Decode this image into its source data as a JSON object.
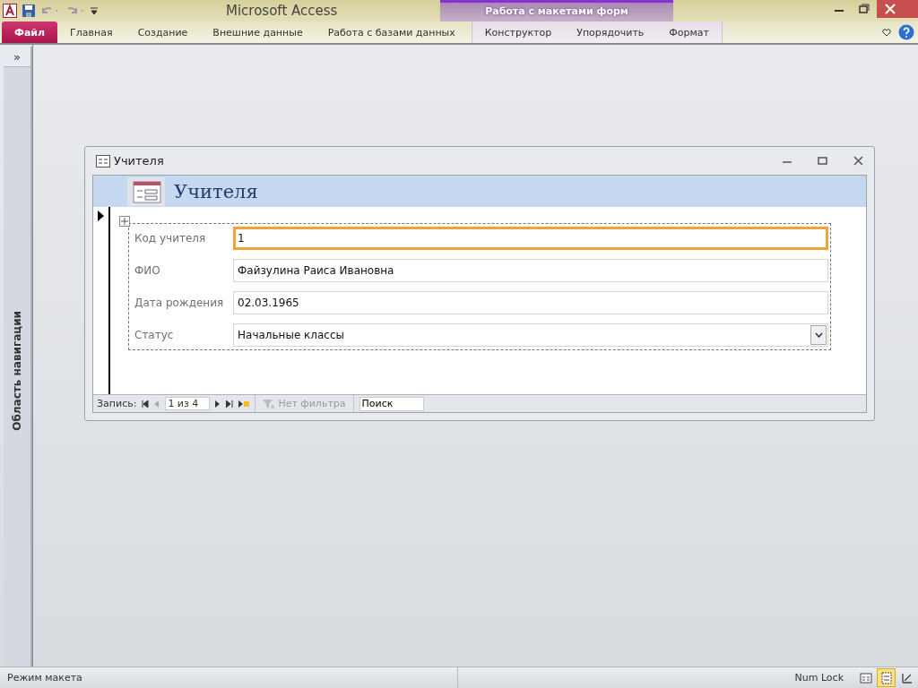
{
  "window": {
    "title": "Microsoft Access",
    "contextual_group": "Работа с макетами форм"
  },
  "ribbon_tabs": [
    {
      "label": "Файл",
      "kind": "file",
      "selected": false
    },
    {
      "label": "Главная",
      "kind": "tab",
      "selected": false
    },
    {
      "label": "Создание",
      "kind": "tab",
      "selected": false
    },
    {
      "label": "Внешние данные",
      "kind": "tab",
      "selected": false
    },
    {
      "label": "Работа с базами данных",
      "kind": "tab",
      "selected": false
    },
    {
      "label": "Конструктор",
      "kind": "context",
      "selected": false
    },
    {
      "label": "Упорядочить",
      "kind": "context",
      "selected": false
    },
    {
      "label": "Формат",
      "kind": "context",
      "selected": false
    }
  ],
  "navigation_pane": {
    "toggle": "»",
    "label": "Область навигации"
  },
  "form_window": {
    "title": "Учителя",
    "header": "Учителя",
    "fields": [
      {
        "label": "Код учителя",
        "value": "1",
        "kind": "text",
        "focused": true
      },
      {
        "label": "ФИО",
        "value": "Файзулина Раиса Ивановна",
        "kind": "text",
        "focused": false
      },
      {
        "label": "Дата рождения",
        "value": "02.03.1965",
        "kind": "text",
        "focused": false
      },
      {
        "label": "Статус",
        "value": "Начальные классы",
        "kind": "combo",
        "focused": false
      }
    ],
    "record_nav": {
      "label": "Запись:",
      "position": "1 из 4",
      "filter": "Нет фильтра",
      "filter_disabled": true,
      "search_placeholder": "Поиск"
    }
  },
  "status_bar": {
    "mode": "Режим макета",
    "num_lock": "Num Lock",
    "views": [
      {
        "kind": "form",
        "selected": false
      },
      {
        "kind": "layout",
        "selected": true
      },
      {
        "kind": "design",
        "selected": false
      }
    ]
  }
}
